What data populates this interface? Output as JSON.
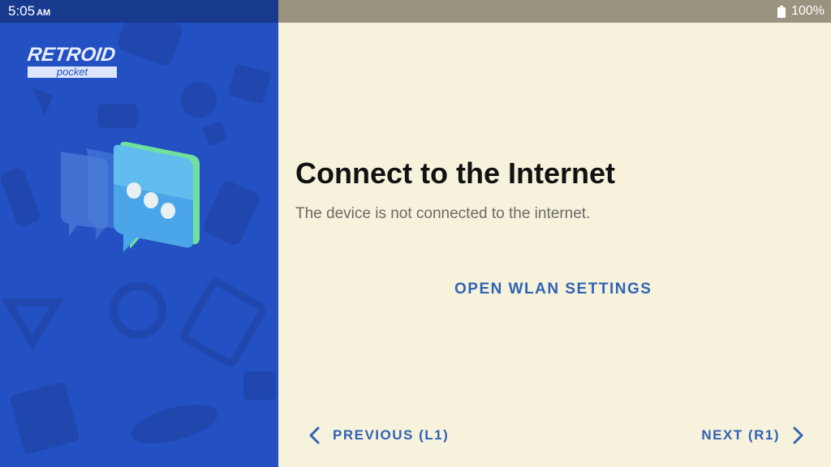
{
  "status_bar": {
    "time": "5:05",
    "ampm": "AM",
    "battery": "100%"
  },
  "brand": {
    "logo_main": "RETROID",
    "logo_sub": "pocket"
  },
  "illustration": {
    "icon": "chat-bubble-icon"
  },
  "main": {
    "title": "Connect to the Internet",
    "subtitle": "The device is not connected to the internet.",
    "wlan_button": "OPEN WLAN SETTINGS"
  },
  "navigation": {
    "previous_label": "PREVIOUS (L1)",
    "next_label": "NEXT (R1)"
  },
  "colors": {
    "panel_blue": "#2350c2",
    "accent": "#2f63b6",
    "background": "#f7f2dc"
  }
}
